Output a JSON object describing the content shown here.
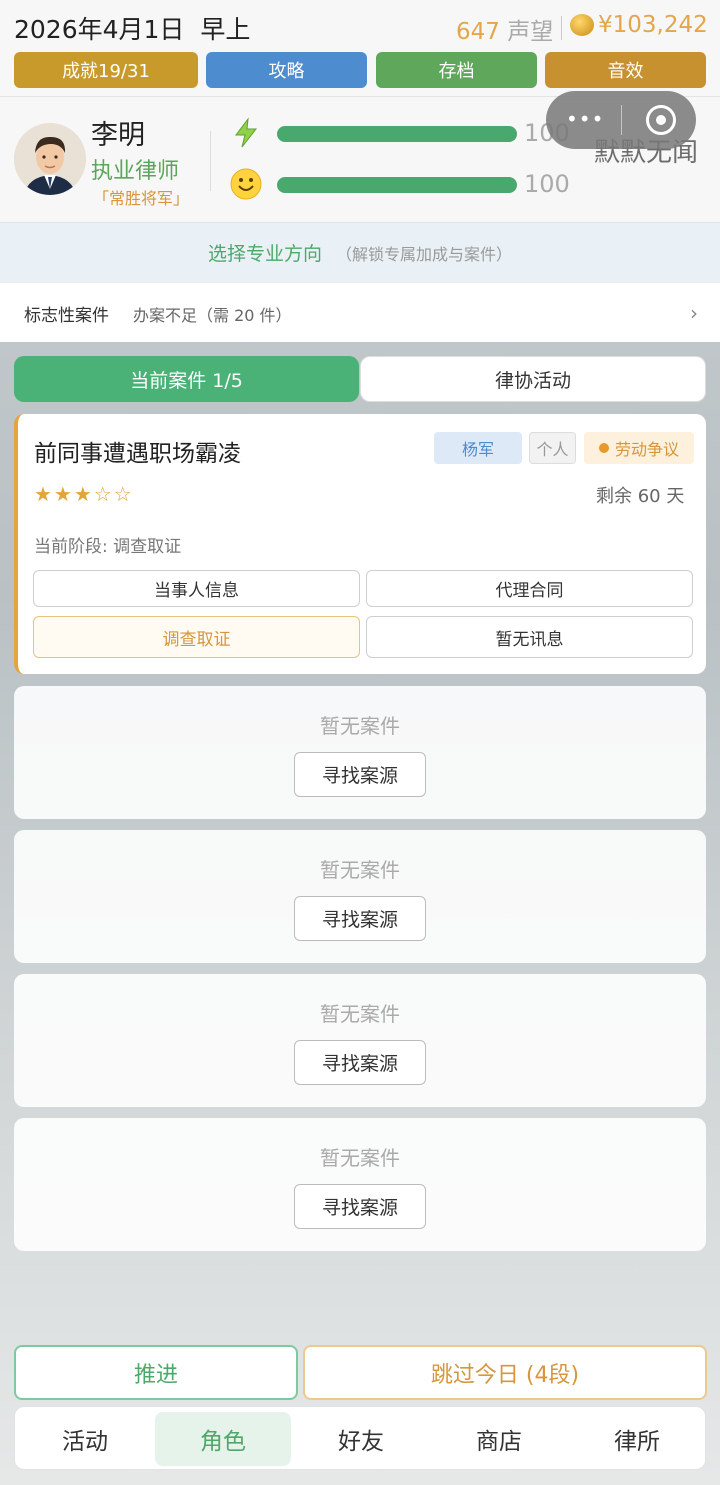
{
  "header": {
    "date": "2026年4月1日",
    "time_of_day": "早上",
    "reputation_value": "647",
    "reputation_unit": "声望",
    "money": "¥103,242",
    "buttons": [
      "成就19/31",
      "攻略",
      "存档",
      "音效"
    ]
  },
  "profile": {
    "name": "李明",
    "title": "执业律师",
    "nickname": "「常胜将军」",
    "energy_value": "100",
    "mood_value": "100",
    "energy_pct": 100,
    "mood_pct": 100,
    "overlay_text": "默默无闻"
  },
  "miniprogram": {
    "more": "•••"
  },
  "specialization": {
    "main": "选择专业方向",
    "sub": "（解锁专属加成与案件）"
  },
  "landmark": {
    "title": "标志性案件",
    "sub": "办案不足（需 20 件）",
    "arrow": "›"
  },
  "tabs": [
    "当前案件 1/5",
    "律协活动"
  ],
  "current_case": {
    "title": "前同事遭遇职场霸凌",
    "client": "杨军",
    "client_type": "个人",
    "category": "劳动争议",
    "stars": "★★★☆☆",
    "rating": 3,
    "remaining": "剩余 60 天",
    "stage": "当前阶段: 调查取证",
    "actions": [
      "当事人信息",
      "代理合同",
      "调查取证",
      "暂无讯息"
    ]
  },
  "empty_slots": [
    {
      "title": "暂无案件",
      "button": "寻找案源"
    },
    {
      "title": "暂无案件",
      "button": "寻找案源"
    },
    {
      "title": "暂无案件",
      "button": "寻找案源"
    },
    {
      "title": "暂无案件",
      "button": "寻找案源"
    }
  ],
  "bottom_actions": {
    "advance": "推进",
    "skip": "跳过今日 (4段)"
  },
  "nav": [
    "活动",
    "角色",
    "好友",
    "商店",
    "律所"
  ],
  "colors": {
    "accent_green": "#4ab177",
    "accent_gold": "#e3a64a",
    "blue": "#4d8ccf"
  }
}
